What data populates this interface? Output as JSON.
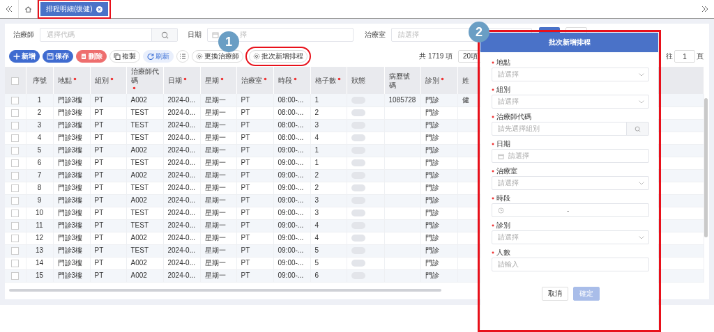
{
  "tabs": [
    {
      "label": "排程明細(復健)",
      "selected": true,
      "highlighted": true
    }
  ],
  "filters": [
    {
      "label": "治療師",
      "kind": "search",
      "placeholder": "選擇代碼"
    },
    {
      "label": "日期",
      "kind": "date",
      "placeholder": "擇"
    },
    {
      "label": "治療室",
      "kind": "select",
      "placeholder": "請選擇"
    }
  ],
  "toolbar": [
    {
      "kind": "add",
      "label": "新增",
      "highlighted": false
    },
    {
      "kind": "save",
      "label": "保存",
      "highlighted": false
    },
    {
      "kind": "delete",
      "label": "刪除",
      "highlighted": false
    },
    {
      "kind": "copy",
      "label": "複製",
      "highlighted": false
    },
    {
      "kind": "refresh",
      "label": "刷新",
      "highlighted": false
    },
    {
      "kind": "list",
      "highlighted": false
    },
    {
      "kind": "swap",
      "label": "更換治療師",
      "highlighted": false
    },
    {
      "kind": "batch",
      "label": "批次新增排程",
      "highlighted": true
    }
  ],
  "pagination": {
    "total": "共 1719 項",
    "page_size": "20項",
    "goto": "往",
    "page": "1",
    "page_unit": "頁"
  },
  "table": {
    "select_all_checked": false,
    "columns": [
      {
        "label": "序號",
        "required": false
      },
      {
        "label": "地點",
        "required": true
      },
      {
        "label": "組別",
        "required": true
      },
      {
        "label": "治療師代碼",
        "required": true
      },
      {
        "label": "日期",
        "required": true
      },
      {
        "label": "星期",
        "required": true
      },
      {
        "label": "治療室",
        "required": true
      },
      {
        "label": "時段",
        "required": true
      },
      {
        "label": "格子數",
        "required": true
      },
      {
        "label": "狀態",
        "required": false
      },
      {
        "label": "病歷號碼",
        "required": false
      },
      {
        "label": "診別",
        "required": true
      },
      {
        "label": "姓",
        "required": false
      }
    ],
    "rows": [
      {
        "checked": false,
        "on": false,
        "cells": [
          "1",
          "門診3樓",
          "PT",
          "A002",
          "2024-0...",
          "星期一",
          "PT",
          "08:00-...",
          "1",
          "",
          "1085728",
          "門診",
          "健"
        ]
      },
      {
        "checked": false,
        "on": false,
        "cells": [
          "2",
          "門診3樓",
          "PT",
          "TEST",
          "2024-0...",
          "星期一",
          "PT",
          "08:00-...",
          "2",
          "",
          "",
          "門診",
          ""
        ]
      },
      {
        "checked": false,
        "on": false,
        "cells": [
          "3",
          "門診3樓",
          "PT",
          "TEST",
          "2024-0...",
          "星期一",
          "PT",
          "08:00-...",
          "3",
          "",
          "",
          "門診",
          ""
        ]
      },
      {
        "checked": false,
        "on": false,
        "cells": [
          "4",
          "門診3樓",
          "PT",
          "TEST",
          "2024-0...",
          "星期一",
          "PT",
          "08:00-...",
          "4",
          "",
          "",
          "門診",
          ""
        ]
      },
      {
        "checked": false,
        "on": false,
        "cells": [
          "5",
          "門診3樓",
          "PT",
          "A002",
          "2024-0...",
          "星期一",
          "PT",
          "09:00-...",
          "1",
          "",
          "",
          "門診",
          ""
        ]
      },
      {
        "checked": false,
        "on": false,
        "cells": [
          "6",
          "門診3樓",
          "PT",
          "TEST",
          "2024-0...",
          "星期一",
          "PT",
          "09:00-...",
          "1",
          "",
          "",
          "門診",
          ""
        ]
      },
      {
        "checked": false,
        "on": false,
        "cells": [
          "7",
          "門診3樓",
          "PT",
          "A002",
          "2024-0...",
          "星期一",
          "PT",
          "09:00-...",
          "2",
          "",
          "",
          "門診",
          ""
        ]
      },
      {
        "checked": false,
        "on": false,
        "cells": [
          "8",
          "門診3樓",
          "PT",
          "TEST",
          "2024-0...",
          "星期一",
          "PT",
          "09:00-...",
          "2",
          "",
          "",
          "門診",
          ""
        ]
      },
      {
        "checked": false,
        "on": false,
        "cells": [
          "9",
          "門診3樓",
          "PT",
          "A002",
          "2024-0...",
          "星期一",
          "PT",
          "09:00-...",
          "3",
          "",
          "",
          "門診",
          ""
        ]
      },
      {
        "checked": false,
        "on": false,
        "cells": [
          "10",
          "門診3樓",
          "PT",
          "TEST",
          "2024-0...",
          "星期一",
          "PT",
          "09:00-...",
          "3",
          "",
          "",
          "門診",
          ""
        ]
      },
      {
        "checked": false,
        "on": false,
        "cells": [
          "11",
          "門診3樓",
          "PT",
          "TEST",
          "2024-0...",
          "星期一",
          "PT",
          "09:00-...",
          "4",
          "",
          "",
          "門診",
          ""
        ]
      },
      {
        "checked": false,
        "on": false,
        "cells": [
          "12",
          "門診3樓",
          "PT",
          "A002",
          "2024-0...",
          "星期一",
          "PT",
          "09:00-...",
          "4",
          "",
          "",
          "門診",
          ""
        ]
      },
      {
        "checked": false,
        "on": false,
        "cells": [
          "13",
          "門診3樓",
          "PT",
          "TEST",
          "2024-0...",
          "星期一",
          "PT",
          "09:00-...",
          "5",
          "",
          "",
          "門診",
          ""
        ]
      },
      {
        "checked": false,
        "on": false,
        "cells": [
          "14",
          "門診3樓",
          "PT",
          "A002",
          "2024-0...",
          "星期一",
          "PT",
          "09:00-...",
          "5",
          "",
          "",
          "門診",
          ""
        ]
      },
      {
        "checked": false,
        "on": false,
        "cells": [
          "15",
          "門診3樓",
          "PT",
          "A002",
          "2024-0...",
          "星期一",
          "PT",
          "09:00-...",
          "6",
          "",
          "",
          "門診",
          ""
        ]
      }
    ]
  },
  "dialog": {
    "title": "批次新增排程",
    "fields": [
      {
        "label": "地點",
        "required": true,
        "kind": "select",
        "placeholder": "請選擇"
      },
      {
        "label": "組別",
        "required": true,
        "kind": "select",
        "placeholder": "請選擇"
      },
      {
        "label": "治療師代碼",
        "required": true,
        "kind": "search",
        "placeholder": "請先選擇組別"
      },
      {
        "label": "日期",
        "required": true,
        "kind": "date",
        "placeholder": "請選擇"
      },
      {
        "label": "治療室",
        "required": true,
        "kind": "select",
        "placeholder": "請選擇"
      },
      {
        "label": "時段",
        "required": true,
        "kind": "time",
        "separator": "-"
      },
      {
        "label": "診別",
        "required": true,
        "kind": "select",
        "placeholder": "請選擇"
      },
      {
        "label": "人數",
        "required": true,
        "kind": "input",
        "placeholder": "請輸入"
      }
    ],
    "buttons": [
      {
        "label": "取消",
        "kind": "plain",
        "disabled": false
      },
      {
        "label": "確定",
        "kind": "primary",
        "disabled": true
      }
    ]
  },
  "callouts": [
    "1",
    "2"
  ]
}
